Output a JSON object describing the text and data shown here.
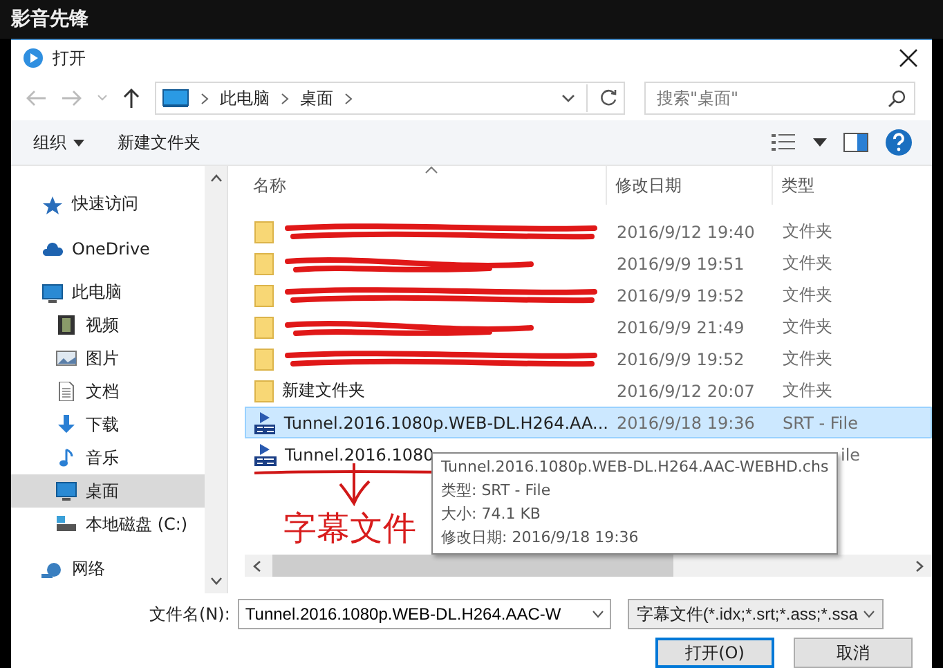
{
  "app_bar": {
    "title": "影音先锋"
  },
  "dialog": {
    "title": "打开"
  },
  "nav": {
    "path": [
      "此电脑",
      "桌面"
    ],
    "search_placeholder": "搜索\"桌面\""
  },
  "toolbar": {
    "organize": "组织",
    "new_folder": "新建文件夹"
  },
  "sidebar": {
    "items": [
      {
        "label": "快速访问",
        "kind": "star",
        "selected": false
      },
      {
        "label": "OneDrive",
        "kind": "cloud",
        "selected": false
      },
      {
        "label": "此电脑",
        "kind": "pc",
        "selected": false,
        "children": [
          {
            "label": "视频",
            "kind": "video",
            "selected": false
          },
          {
            "label": "图片",
            "kind": "picture",
            "selected": false
          },
          {
            "label": "文档",
            "kind": "doc",
            "selected": false
          },
          {
            "label": "下载",
            "kind": "download",
            "selected": false
          },
          {
            "label": "音乐",
            "kind": "music",
            "selected": false
          },
          {
            "label": "桌面",
            "kind": "desktop",
            "selected": true
          },
          {
            "label": "本地磁盘 (C:)",
            "kind": "disk",
            "selected": false
          }
        ]
      },
      {
        "label": "网络",
        "kind": "network",
        "selected": false
      }
    ]
  },
  "table": {
    "columns": [
      "名称",
      "修改日期",
      "类型"
    ],
    "rows": [
      {
        "kind": "folder",
        "date": "2016/9/12 19:40",
        "type": "文件夹",
        "selected": false
      },
      {
        "kind": "folder",
        "date": "2016/9/9 19:51",
        "type": "文件夹",
        "selected": false
      },
      {
        "kind": "folder",
        "date": "2016/9/9 19:52",
        "type": "文件夹",
        "selected": false
      },
      {
        "kind": "folder",
        "date": "2016/9/9 21:49",
        "type": "文件夹",
        "selected": false
      },
      {
        "kind": "folder",
        "date": "2016/9/9 19:52",
        "type": "文件夹",
        "selected": false
      },
      {
        "kind": "folder",
        "name": "新建文件夹",
        "date": "2016/9/12 20:07",
        "type": "文件夹",
        "selected": false
      },
      {
        "kind": "srt",
        "name": "Tunnel.2016.1080p.WEB-DL.H264.AA...",
        "date": "2016/9/18 19:36",
        "type": "SRT - File",
        "selected": true
      },
      {
        "kind": "srt",
        "name": "Tunnel.2016.1080",
        "type": "ile",
        "selected": false,
        "tooltip": [
          "Tunnel.2016.1080p.WEB-DL.H264.AAC-WEBHD.chs",
          "类型: SRT - File",
          "大小: 74.1 KB",
          "修改日期: 2016/9/18 19:36"
        ]
      }
    ]
  },
  "annotation": {
    "text": "字幕文件"
  },
  "footer": {
    "filename_label": "文件名(N):",
    "filename": "Tunnel.2016.1080p.WEB-DL.H264.AAC-W",
    "filter": "字幕文件(*.idx;*.srt;*.ass;*.ssa",
    "buttons": [
      {
        "label": "打开(O)",
        "selected": true
      },
      {
        "label": "取消",
        "selected": false
      }
    ]
  }
}
